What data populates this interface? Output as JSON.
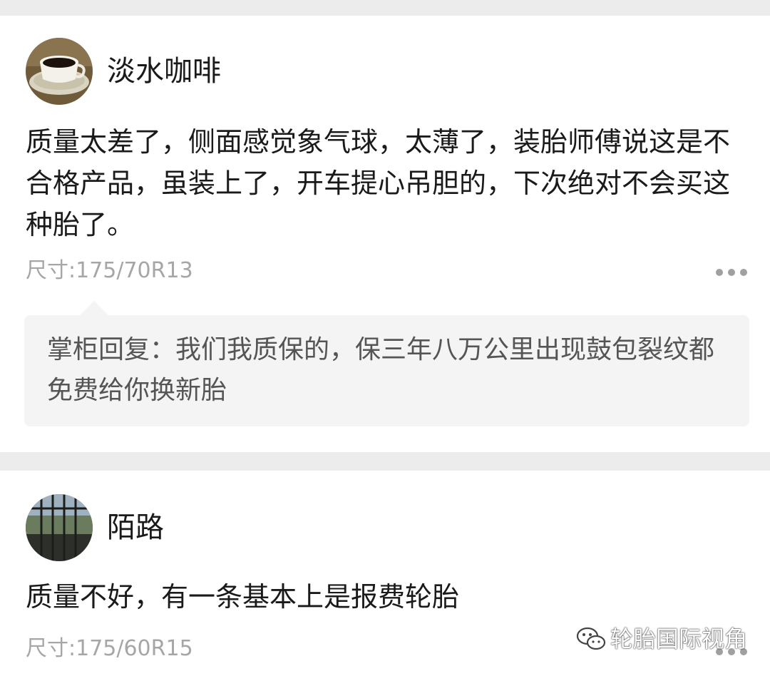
{
  "reviews": [
    {
      "user": {
        "name": "淡水咖啡",
        "avatar": "coffee-cup"
      },
      "comment": "质量太差了，侧面感觉象气球，太薄了，装胎师傅说这是不合格产品，虽装上了，开车提心吊胆的，下次绝对不会买这种胎了。",
      "spec": "尺寸:175/70R13",
      "reply": "掌柜回复：我们我质保的，保三年八万公里出现鼓包裂纹都免费给你换新胎"
    },
    {
      "user": {
        "name": "陌路",
        "avatar": "window-bars"
      },
      "comment": "质量不好，有一条基本上是报费轮胎",
      "spec": "尺寸:175/60R15"
    }
  ],
  "watermark": {
    "text": "轮胎国际视角",
    "icon": "wechat-icon"
  },
  "colors": {
    "background": "#ececec",
    "card": "#ffffff",
    "reply_bg": "#f4f4f4",
    "muted_text": "#a6a6a6"
  }
}
